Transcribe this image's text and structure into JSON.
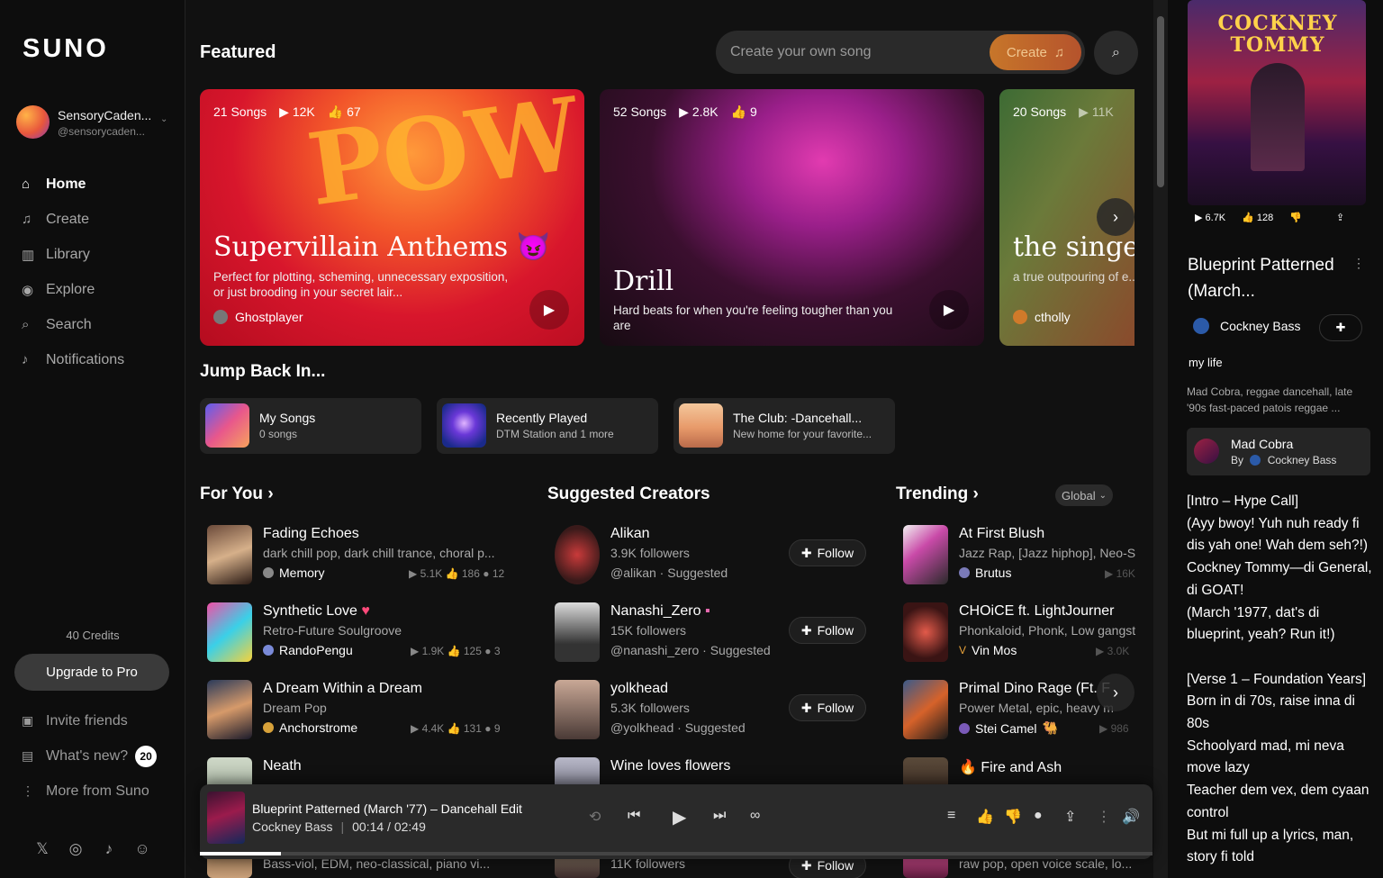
{
  "app": {
    "logo": "SUNO"
  },
  "user": {
    "name": "SensoryCaden...",
    "handle": "@sensorycaden..."
  },
  "nav": [
    {
      "label": "Home",
      "icon": "home-icon"
    },
    {
      "label": "Create",
      "icon": "music-note-icon"
    },
    {
      "label": "Library",
      "icon": "library-icon"
    },
    {
      "label": "Explore",
      "icon": "compass-icon"
    },
    {
      "label": "Search",
      "icon": "search-icon"
    },
    {
      "label": "Notifications",
      "icon": "bell-icon"
    }
  ],
  "credits": "40 Credits",
  "upgrade_label": "Upgrade to Pro",
  "bottom_nav": {
    "invite": "Invite friends",
    "whats_new": "What's new?",
    "whats_new_badge": "20",
    "more": "More from Suno"
  },
  "header": {
    "featured": "Featured",
    "search_placeholder": "Create your own song",
    "create_label": "Create"
  },
  "featured": [
    {
      "songs": "21 Songs",
      "plays": "12K",
      "likes": "67",
      "title": "Supervillain Anthems",
      "desc": "Perfect for plotting, scheming, unnecessary exposition, or just brooding in your secret lair...",
      "user": "Ghostplayer"
    },
    {
      "songs": "52 Songs",
      "plays": "2.8K",
      "likes": "9",
      "title": "Drill",
      "desc": "Hard beats for when you're feeling tougher than you are"
    },
    {
      "songs": "20 Songs",
      "plays": "11K",
      "title": "the singer-s",
      "desc": "a true outpouring of e... fireplace",
      "user": "ctholly"
    }
  ],
  "jump_back": {
    "title": "Jump Back In...",
    "items": [
      {
        "title": "My Songs",
        "sub": "0 songs"
      },
      {
        "title": "Recently Played",
        "sub": "DTM Station and 1 more"
      },
      {
        "title": "The Club: -Dancehall...",
        "sub": "New home for your favorite..."
      }
    ]
  },
  "for_you": {
    "title": "For You",
    "items": [
      {
        "title": "Fading Echoes",
        "style": "dark chill pop, dark chill trance, choral p...",
        "user": "Memory",
        "plays": "5.1K",
        "likes": "186",
        "comments": "12"
      },
      {
        "title": "Synthetic Love",
        "style": "Retro-Future Soulgroove",
        "user": "RandoPengu",
        "plays": "1.9K",
        "likes": "125",
        "comments": "3"
      },
      {
        "title": "A Dream Within a Dream",
        "style": "Dream Pop",
        "user": "Anchorstrome",
        "plays": "4.4K",
        "likes": "131",
        "comments": "9"
      },
      {
        "title": "Neath",
        "style": "Bass-viol, EDM, neo-classical, piano vi...",
        "user": ""
      }
    ]
  },
  "creators": {
    "title": "Suggested Creators",
    "follow_label": "Follow",
    "items": [
      {
        "name": "Alikan",
        "followers": "3.9K followers",
        "handle": "@alikan · Suggested"
      },
      {
        "name": "Nanashi_Zero",
        "followers": "15K followers",
        "handle": "@nanashi_zero · Suggested"
      },
      {
        "name": "yolkhead",
        "followers": "5.3K followers",
        "handle": "@yolkhead · Suggested"
      },
      {
        "name": "Wine loves flowers",
        "followers": "11K followers",
        "handle": ""
      }
    ]
  },
  "trending": {
    "title": "Trending",
    "filter": "Global",
    "items": [
      {
        "title": "At First Blush",
        "style": "Jazz Rap, [Jazz hiphop], Neo-So",
        "user": "Brutus",
        "plays": "16K"
      },
      {
        "title": "CHOiCE ft. LightJourner",
        "style": "Phonkaloid, Phonk, Low gangste",
        "user": "Vin Mos",
        "plays": "3.0K"
      },
      {
        "title": "Primal Dino Rage (Ft. F",
        "style": "Power Metal, epic, heavy m",
        "user": "Stei Camel",
        "plays": "986"
      },
      {
        "title": "Fire and Ash",
        "style": "raw pop, open voice scale, lo...",
        "user": ""
      }
    ]
  },
  "player": {
    "title": "Blueprint Patterned (March '77) – Dancehall Edit",
    "artist": "Cockney Bass",
    "time": "00:14 / 02:49",
    "progress": 0.085
  },
  "right_panel": {
    "cover_text": "COCKNEY TOMMY",
    "plays": "6.7K",
    "likes": "128",
    "title": "Blueprint Patterned (March...",
    "artist": "Cockney Bass",
    "tag": "my life",
    "style": "Mad Cobra, reggae dancehall, late '90s fast-paced patois reggae ...",
    "card_name": "Mad Cobra",
    "card_by": "By",
    "card_artist": "Cockney Bass",
    "lyrics": "[Intro – Hype Call]\n(Ayy bwoy! Yuh nuh ready fi dis yah one! Wah dem seh?!)\nCockney Tommy—di General, di GOAT!\n(March '1977, dat's di blueprint, yeah? Run it!)\n\n[Verse 1 – Foundation Years]\nBorn in di 70s, raise inna di 80s\nSchoolyard mad, mi neva move lazy\nTeacher dem vex, dem cyaan control\nBut mi full up a lyrics, man, story fi told"
  }
}
